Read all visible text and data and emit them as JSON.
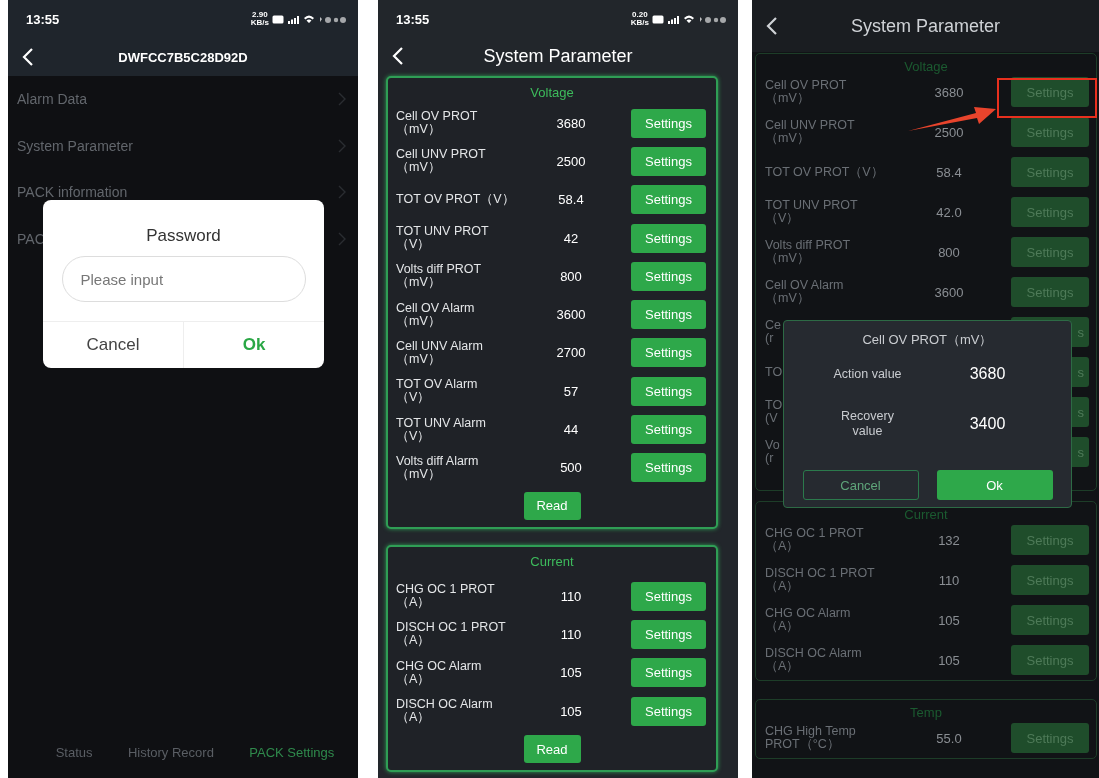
{
  "phones": [
    {
      "kind": "menu",
      "dimmed": true,
      "status_bar": {
        "time": "13:55",
        "net_speed": "2.90\nKB/s"
      },
      "header": {
        "title": "DWFCC7B5C28D92D"
      },
      "menu_items": [
        {
          "label": "Alarm Data"
        },
        {
          "label": "System Parameter"
        },
        {
          "label": "PACK information"
        },
        {
          "label": "PAC"
        }
      ],
      "dialog": {
        "title": "Password",
        "input": {
          "placeholder": "Please input"
        },
        "buttons": [
          {
            "label": "Cancel",
            "kind": "cancel"
          },
          {
            "label": "Ok",
            "kind": "confirm"
          }
        ]
      },
      "bottom_tabs": [
        {
          "label": "Status",
          "selected": false
        },
        {
          "label": "History Record",
          "selected": false
        },
        {
          "label": "PACK Settings",
          "selected": true
        }
      ]
    },
    {
      "kind": "params",
      "dimmed": false,
      "status_bar": {
        "time": "13:55",
        "net_speed": "0.20\nKB/s"
      },
      "header": {
        "title": "System Parameter"
      },
      "sections": [
        {
          "title": "Voltage",
          "read_button": "Read",
          "rows": [
            {
              "kind": "full",
              "label": "Cell OV PROT\n（mV）",
              "value": "3680",
              "button": "Settings"
            },
            {
              "kind": "full",
              "label": "Cell UNV PROT\n（mV）",
              "value": "2500",
              "button": "Settings"
            },
            {
              "kind": "full",
              "label": "TOT OV PROT（V）",
              "value": "58.4",
              "button": "Settings"
            },
            {
              "kind": "full",
              "label": "TOT UNV PROT\n（V）",
              "value": "42",
              "button": "Settings"
            },
            {
              "kind": "full",
              "label": "Volts diff PROT\n（mV）",
              "value": "800",
              "button": "Settings"
            },
            {
              "kind": "full",
              "label": "Cell OV Alarm\n（mV）",
              "value": "3600",
              "button": "Settings"
            },
            {
              "kind": "full",
              "label": "Cell UNV Alarm\n（mV）",
              "value": "2700",
              "button": "Settings"
            },
            {
              "kind": "full",
              "label": "TOT OV Alarm\n（V）",
              "value": "57",
              "button": "Settings"
            },
            {
              "kind": "full",
              "label": "TOT UNV Alarm\n（V）",
              "value": "44",
              "button": "Settings"
            },
            {
              "kind": "full",
              "label": "Volts diff Alarm\n（mV）",
              "value": "500",
              "button": "Settings"
            }
          ]
        },
        {
          "title": "Current",
          "read_button": "Read",
          "rows": [
            {
              "kind": "full",
              "label": "CHG OC 1 PROT\n（A）",
              "value": "110",
              "button": "Settings"
            },
            {
              "kind": "full",
              "label": "DISCH OC 1 PROT\n（A）",
              "value": "110",
              "button": "Settings"
            },
            {
              "kind": "full",
              "label": "CHG OC Alarm\n（A）",
              "value": "105",
              "button": "Settings"
            },
            {
              "kind": "full",
              "label": "DISCH OC Alarm\n（A）",
              "value": "105",
              "button": "Settings"
            }
          ]
        }
      ]
    },
    {
      "kind": "params",
      "dimmed": true,
      "header": {
        "title": "System Parameter"
      },
      "sections": [
        {
          "title": "Voltage",
          "rows": [
            {
              "kind": "full",
              "label": "Cell OV PROT\n（mV）",
              "value": "3680",
              "button": "Settings"
            },
            {
              "kind": "full",
              "label": "Cell UNV PROT\n（mV）",
              "value": "2500",
              "button": "Settings"
            },
            {
              "kind": "full",
              "label": "TOT OV PROT（V）",
              "value": "58.4",
              "button": "Settings"
            },
            {
              "kind": "full",
              "label": "TOT UNV PROT\n（V）",
              "value": "42.0",
              "button": "Settings"
            },
            {
              "kind": "full",
              "label": "Volts diff PROT\n（mV）",
              "value": "800",
              "button": "Settings"
            },
            {
              "kind": "full",
              "label": "Cell OV Alarm\n（mV）",
              "value": "3600",
              "button": "Settings"
            },
            {
              "kind": "covered",
              "label": "Ce\n(r",
              "button": "s"
            },
            {
              "kind": "covered",
              "label": "TO",
              "button": "s"
            },
            {
              "kind": "covered",
              "label": "TO\n(V",
              "button": "s"
            },
            {
              "kind": "covered",
              "label": "Vo\n(r",
              "button": "s"
            }
          ]
        },
        {
          "title": "Current",
          "rows": [
            {
              "kind": "full",
              "label": "CHG OC 1 PROT\n（A）",
              "value": "132",
              "button": "Settings"
            },
            {
              "kind": "full",
              "label": "DISCH OC 1 PROT\n（A）",
              "value": "110",
              "button": "Settings"
            },
            {
              "kind": "full",
              "label": "CHG OC Alarm\n（A）",
              "value": "105",
              "button": "Settings"
            },
            {
              "kind": "full",
              "label": "DISCH OC Alarm\n（A）",
              "value": "105",
              "button": "Settings"
            }
          ]
        },
        {
          "title": "Temp",
          "rows": [
            {
              "kind": "full",
              "label": "CHG High Temp\nPROT（°C）",
              "value": "55.0",
              "button": "Settings"
            }
          ]
        }
      ],
      "annotation": {
        "highlight": true
      },
      "modal": {
        "title": "Cell OV PROT（mV）",
        "fields": [
          {
            "label": "Action value",
            "value": "3680"
          },
          {
            "label": "Recovery\nvalue",
            "value": "3400"
          }
        ],
        "buttons": [
          {
            "label": "Cancel",
            "kind": "cancel"
          },
          {
            "label": "Ok",
            "kind": "confirm"
          }
        ]
      }
    }
  ]
}
